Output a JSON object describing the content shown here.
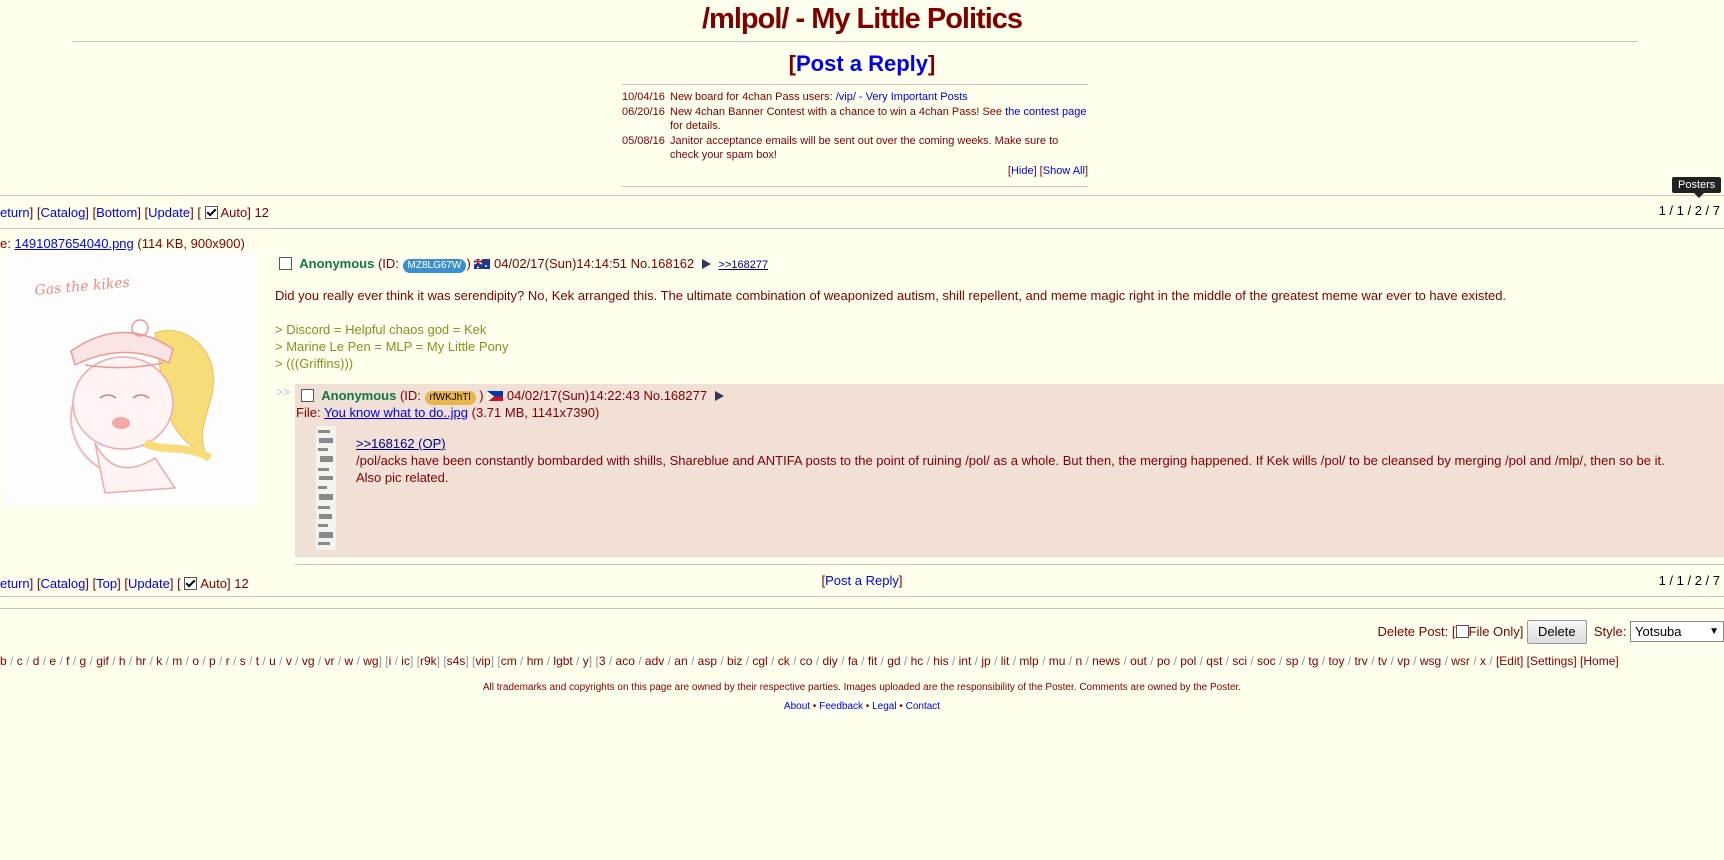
{
  "board": {
    "title": "/mlpol/ - My Little Politics"
  },
  "post_reply": {
    "open": "[",
    "label": "Post a Reply",
    "close": "]"
  },
  "news": [
    {
      "date": "10/04/16",
      "text": "New board for 4chan Pass users: ",
      "link": "/vip/ - Very Important Posts",
      "after": ""
    },
    {
      "date": "06/20/16",
      "text": "New 4chan Banner Contest with a chance to win a 4chan Pass! See ",
      "link": "the contest page",
      "after": " for details."
    },
    {
      "date": "05/08/16",
      "text": "Janitor acceptance emails will be sent out over the coming weeks. Make sure to check your spam box!",
      "link": "",
      "after": ""
    }
  ],
  "news_controls": {
    "hide": "Hide",
    "show_all": "Show All"
  },
  "nav_top": {
    "return": "eturn",
    "catalog": "Catalog",
    "bottom": "Bottom",
    "update": "Update",
    "auto": "Auto",
    "count": "12"
  },
  "nav_bottom": {
    "return": "eturn",
    "catalog": "Catalog",
    "top": "Top",
    "update": "Update",
    "auto": "Auto",
    "count": "12"
  },
  "thread_stats": "1 / 1 / 2 / 7",
  "tooltip": "Posters",
  "op": {
    "file_prefix": "e: ",
    "file_name": "1491087654040.png",
    "file_info": " (114 KB, 900x900)",
    "thumb_caption": "Gas the kikes",
    "name": "Anonymous",
    "id_prefix": " (ID: ",
    "id": "MZ8LG67W",
    "id_suffix": ")",
    "id_color": "#3b8fd0",
    "datetime": "04/02/17(Sun)14:14:51",
    "number": "No.168162",
    "backlink": ">>168277",
    "comment": "Did you really ever think it was serendipity? No, Kek arranged this. The ultimate combination of weaponized autism, shill repellent, and meme magic right in the middle of the greatest meme war ever to have existed.",
    "quotes": [
      "> Discord = Helpful chaos god = Kek",
      "> Marine Le Pen = MLP = My Little Pony",
      "> (((Griffins)))"
    ]
  },
  "reply": {
    "side_arrows": ">>",
    "name": "Anonymous",
    "id_prefix": " (ID: ",
    "id": "rfWKJhTl",
    "id_suffix": " )",
    "id_color": "#e8b64a",
    "datetime": "04/02/17(Sun)14:22:43",
    "number": "No.168277",
    "file_prefix": "File: ",
    "file_name": "You know what to do..jpg",
    "file_info": " (3.71 MB, 1141x7390)",
    "quote_link": ">>168162 (OP)",
    "comment_1": "/pol/acks have been constantly bombarded with shills, Shareblue and ANTIFA posts to the point of ruining /pol/ as a whole. But then, the merging happened. If Kek wills /pol/ to be cleansed by merging /pol and /mlp/, then so be it.",
    "comment_2": "Also pic related."
  },
  "bottom_reply": "Post a Reply",
  "delete_form": {
    "label": "Delete Post: [",
    "file_only": "File Only",
    "close": "]",
    "button": "Delete",
    "style_label": "Style:",
    "style_value": "Yotsuba"
  },
  "boards_group1": [
    "b",
    "c",
    "d",
    "e",
    "f",
    "g",
    "gif",
    "h",
    "hr",
    "k",
    "m",
    "o",
    "p",
    "r",
    "s",
    "t",
    "u",
    "v",
    "vg",
    "vr",
    "w",
    "wg"
  ],
  "boards_group2": [
    "i",
    "ic"
  ],
  "boards_group3": [
    "r9k"
  ],
  "boards_group4": [
    "s4s"
  ],
  "boards_group5": [
    "vip"
  ],
  "boards_group6": [
    "cm",
    "hm",
    "lgbt",
    "y"
  ],
  "boards_group7": [
    "3",
    "aco",
    "adv",
    "an",
    "asp",
    "biz",
    "cgl",
    "ck",
    "co",
    "diy",
    "fa",
    "fit",
    "gd",
    "hc",
    "his",
    "int",
    "jp",
    "lit",
    "mlp",
    "mu",
    "n",
    "news",
    "out",
    "po",
    "pol",
    "qst",
    "sci",
    "soc",
    "sp",
    "tg",
    "toy",
    "trv",
    "tv",
    "vp",
    "wsg",
    "wsr",
    "x"
  ],
  "boards_edit": "Edit",
  "boards_settings": "Settings",
  "boards_home": "Home",
  "footer": {
    "disclaimer": "All trademarks and copyrights on this page are owned by their respective parties. Images uploaded are the responsibility of the Poster. Comments are owned by the Poster.",
    "links": [
      "About",
      "Feedback",
      "Legal",
      "Contact"
    ]
  }
}
